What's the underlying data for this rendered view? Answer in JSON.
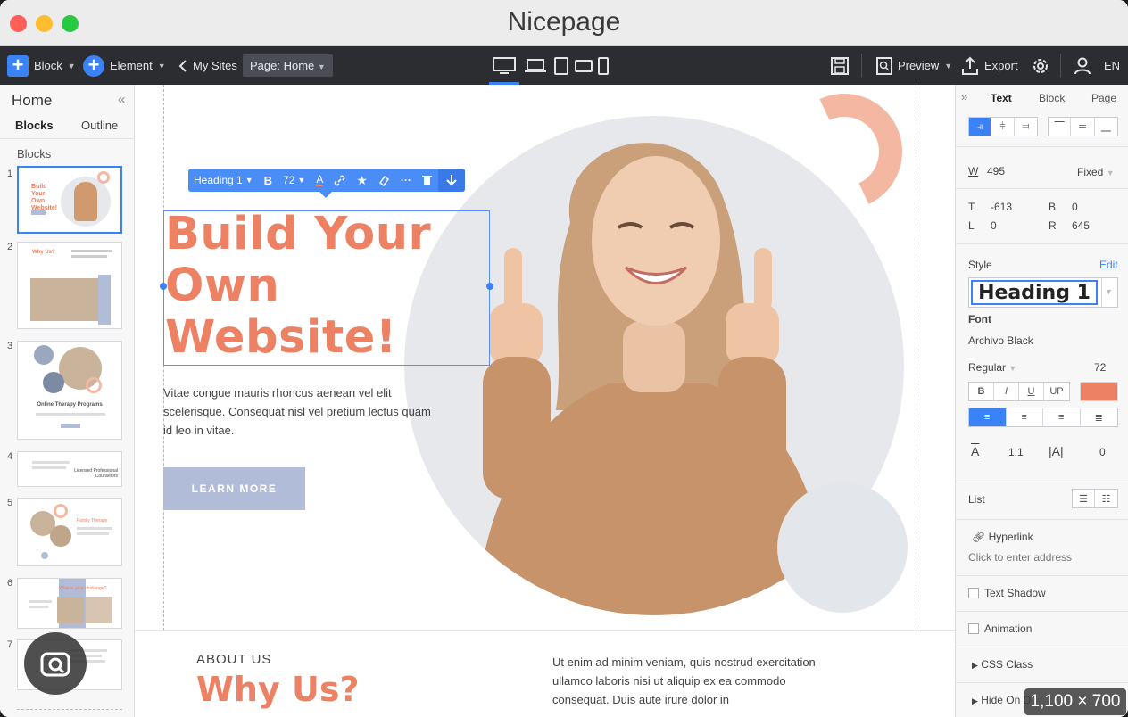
{
  "window": {
    "title": "Nicepage"
  },
  "toolbar": {
    "block_label": "Block",
    "element_label": "Element",
    "my_sites_label": "My Sites",
    "page_selector": "Page: Home",
    "preview_label": "Preview",
    "export_label": "Export",
    "language": "EN"
  },
  "left_panel": {
    "title": "Home",
    "tabs": [
      "Blocks",
      "Outline"
    ],
    "section_label": "Blocks",
    "thumbnails": [
      {
        "num": "1",
        "caption": "Build Your Own Website!"
      },
      {
        "num": "2",
        "caption": "Why Us?"
      },
      {
        "num": "3",
        "caption": "Online Therapy Programs"
      },
      {
        "num": "4",
        "caption": "Licensed Professional Counselors"
      },
      {
        "num": "5",
        "caption": "Family Therapy"
      },
      {
        "num": "6",
        "caption": "What is your challenge?"
      },
      {
        "num": "7",
        "caption": ""
      }
    ]
  },
  "format_bar": {
    "style": "Heading 1",
    "bold": "B",
    "size": "72"
  },
  "canvas": {
    "hero_title": "Build Your Own Website!",
    "hero_text": "Vitae congue mauris rhoncus aenean vel elit scelerisque. Consequat nisl vel pretium lectus quam id leo in vitae.",
    "learn_more": "LEARN MORE",
    "about_label": "ABOUT US",
    "about_title": "Why Us?",
    "about_text": "Ut enim ad minim veniam, quis nostrud exercitation ullamco laboris nisi ut aliquip ex ea commodo consequat. Duis aute irure dolor in"
  },
  "right_panel": {
    "tabs": [
      "Text",
      "Block",
      "Page"
    ],
    "width_label": "W",
    "width_value": "495",
    "width_mode": "Fixed",
    "t_label": "T",
    "t_value": "-613",
    "b_label": "B",
    "b_value": "0",
    "l_label": "L",
    "l_value": "0",
    "r_label": "R",
    "r_value": "645",
    "style_label": "Style",
    "edit_label": "Edit",
    "style_value": "Heading 1",
    "font_label": "Font",
    "font_value": "Archivo Black",
    "weight_value": "Regular",
    "size_value": "72",
    "format_buttons": [
      "B",
      "I",
      "U",
      "UP"
    ],
    "text_color": "#ec8163",
    "line_height": "1.1",
    "letter_spacing": "0",
    "list_label": "List",
    "hyperlink_label": "Hyperlink",
    "hyperlink_placeholder": "Click to enter address",
    "text_shadow_label": "Text Shadow",
    "animation_label": "Animation",
    "css_class_label": "CSS Class",
    "hide_on_label": "Hide On D"
  },
  "overlay": {
    "size_badge": "1,100 × 700"
  },
  "colors": {
    "accent": "#3b82f6",
    "brand": "#ec8163",
    "button": "#b1bcd9"
  }
}
